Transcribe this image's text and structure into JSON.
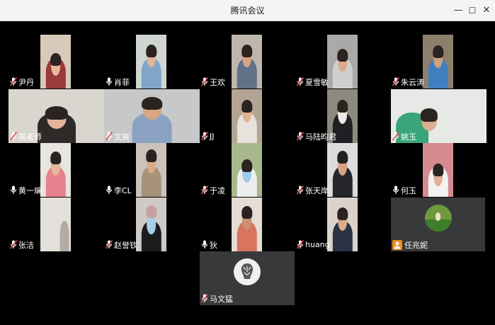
{
  "window": {
    "title": "腾讯会议",
    "minimize_glyph": "—",
    "maximize_glyph": "☐",
    "close_glyph": "✕"
  },
  "participants": [
    {
      "name": "尹丹",
      "mic": "muted"
    },
    {
      "name": "肖菲",
      "mic": "on"
    },
    {
      "name": "王欢",
      "mic": "muted"
    },
    {
      "name": "夏雪敏",
      "mic": "muted"
    },
    {
      "name": "朱云涛",
      "mic": "muted"
    },
    {
      "name": "高老师",
      "mic": "muted"
    },
    {
      "name": "文爽",
      "mic": "muted"
    },
    {
      "name": "JJ",
      "mic": "muted"
    },
    {
      "name": "马陆昀君",
      "mic": "muted"
    },
    {
      "name": "姚玉",
      "mic": "muted"
    },
    {
      "name": "黄一斓",
      "mic": "on"
    },
    {
      "name": "李CL",
      "mic": "on"
    },
    {
      "name": "于凌",
      "mic": "muted"
    },
    {
      "name": "张天岸",
      "mic": "muted"
    },
    {
      "name": "何玉",
      "mic": "on"
    },
    {
      "name": "张洁",
      "mic": "muted"
    },
    {
      "name": "赵誉钦",
      "mic": "muted"
    },
    {
      "name": "狄",
      "mic": "on"
    },
    {
      "name": "huang",
      "mic": "muted"
    },
    {
      "name": "任兆妮",
      "mic": "none",
      "video": "off"
    },
    {
      "name": "马文猛",
      "mic": "muted",
      "video": "off"
    }
  ],
  "colors": {
    "muted_mic": "#e5484d",
    "accent_user": "#f08c1e",
    "avatar_tile_bg": "#38393b"
  }
}
